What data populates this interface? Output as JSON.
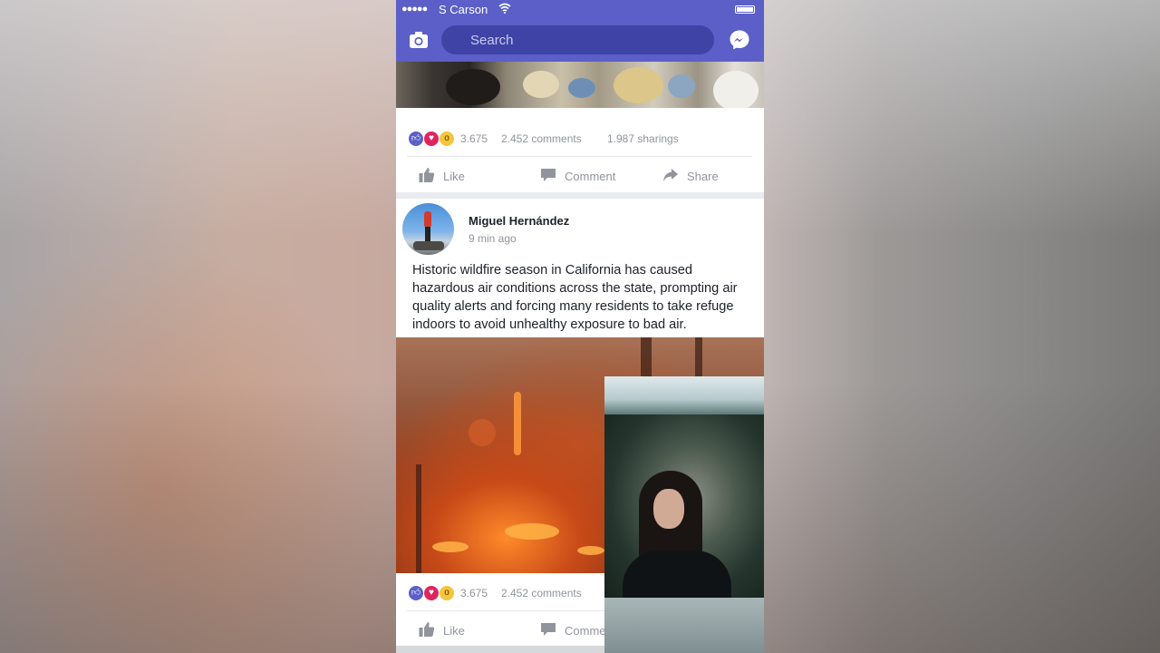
{
  "status_bar": {
    "signal_dots": "●●●●●",
    "carrier": "S Carson"
  },
  "nav": {
    "search_placeholder": "Search"
  },
  "post_top": {
    "reaction_count": "3.675",
    "comments": "2.452 comments",
    "sharings": "1.987 sharings",
    "actions": {
      "like": "Like",
      "comment": "Comment",
      "share": "Share"
    }
  },
  "post_main": {
    "author": "Miguel Hernández",
    "time": "9 min ago",
    "text": "Historic wildfire season in California has caused hazardous air conditions across the state, prompting air quality alerts and forcing many residents to take refuge indoors to avoid unhealthy exposure to bad air.",
    "reaction_count": "3.675",
    "comments": "2.452 comments",
    "actions": {
      "like": "Like",
      "comment": "Comme"
    }
  },
  "colors": {
    "brand": "#5b5fc7",
    "search_bg": "#3f43a6",
    "meta_text": "#90949c"
  },
  "icons": [
    "camera-icon",
    "wifi-icon",
    "battery-icon",
    "messenger-icon",
    "like-icon",
    "love-icon",
    "wow-icon",
    "thumbs-up-icon",
    "comment-icon",
    "share-icon"
  ]
}
